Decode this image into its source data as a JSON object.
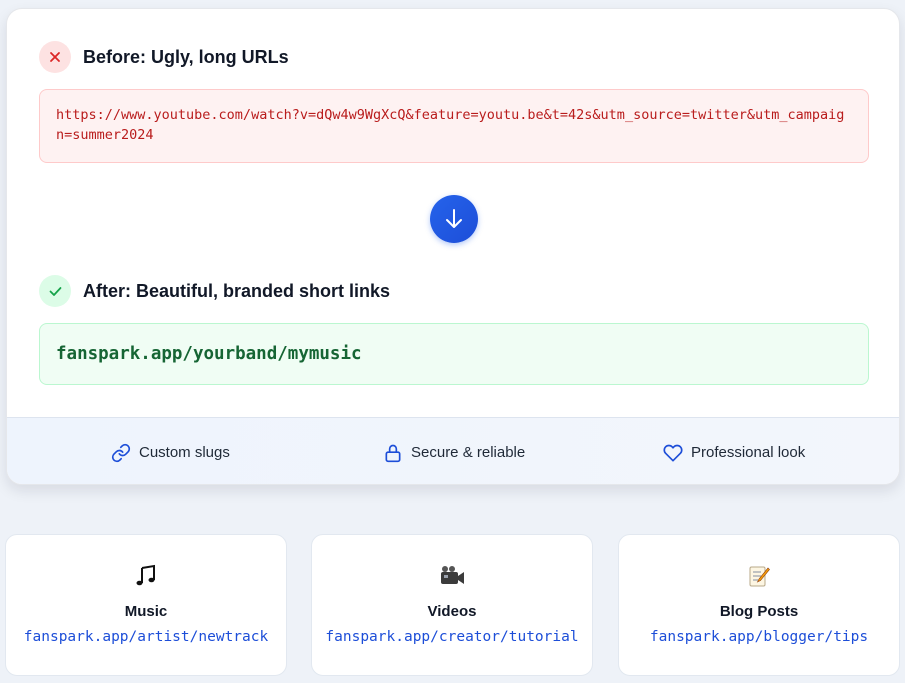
{
  "before": {
    "title": "Before: Ugly, long URLs",
    "url": "https://www.youtube.com/watch?v=dQw4w9WgXcQ&feature=youtu.be&t=42s&utm_source=twitter&utm_campaign=summer2024"
  },
  "after": {
    "title": "After: Beautiful, branded short links",
    "url": "fanspark.app/yourband/mymusic"
  },
  "features": [
    {
      "label": "Custom slugs",
      "icon": "link-icon"
    },
    {
      "label": "Secure & reliable",
      "icon": "lock-icon"
    },
    {
      "label": "Professional look",
      "icon": "heart-icon"
    }
  ],
  "examples": [
    {
      "title": "Music",
      "link": "fanspark.app/artist/newtrack",
      "icon": "music-note-icon"
    },
    {
      "title": "Videos",
      "link": "fanspark.app/creator/tutorial",
      "icon": "video-camera-icon"
    },
    {
      "title": "Blog Posts",
      "link": "fanspark.app/blogger/tips",
      "icon": "memo-icon"
    }
  ],
  "colors": {
    "accent": "#2563eb",
    "bad": "#b91c1c",
    "good": "#166534"
  }
}
